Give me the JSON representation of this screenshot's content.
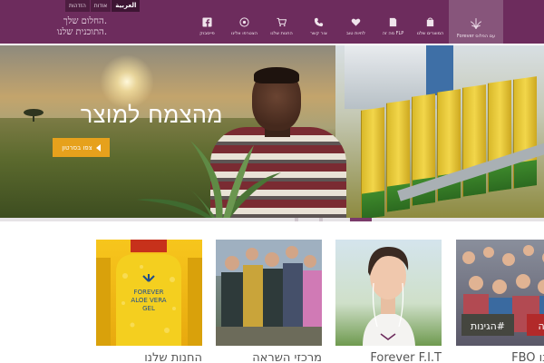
{
  "header": {
    "language_links": [
      "العربية",
      "אודות",
      "הזדהות"
    ],
    "tagline_lines": [
      "החלום שלך.",
      "התוכנית שלנו."
    ],
    "nav": [
      {
        "label": "Forever עם הפלוס",
        "icon": "plus-leaf-icon",
        "active": true
      },
      {
        "label": "המוצרים שלנו",
        "icon": "bag-icon",
        "active": false
      },
      {
        "label": "מה זה FLP",
        "icon": "document-icon",
        "active": false
      },
      {
        "label": "לחיות טוב",
        "icon": "heart-icon",
        "active": false
      },
      {
        "label": "צור קשר",
        "icon": "phone-icon",
        "active": false
      },
      {
        "label": "החנות שלנו",
        "icon": "cart-icon",
        "active": false
      },
      {
        "label": "הצטרפו אלינו",
        "icon": "target-icon",
        "active": false
      },
      {
        "label": "פייסבוק",
        "icon": "facebook-icon",
        "active": false
      }
    ]
  },
  "hero": {
    "title": "מהצמח למוצר",
    "button_label": "צפו בסרטון",
    "button_icon": "play-triangle-icon"
  },
  "colors": {
    "header_bg": "#6d2c5d",
    "nav_active_bg": "#87557b",
    "button_bg": "#e6a11c",
    "slider_active": "#7a3a6a"
  },
  "cards": [
    {
      "title": "FBO שלנו",
      "image": "crowd-people-photo"
    },
    {
      "title": "Forever F.I.T",
      "image": "woman-headphones-photo"
    },
    {
      "title": "מרכזי השראה",
      "image": "group-hikers-photo"
    },
    {
      "title": "החנות שלנו",
      "image": "aloe-vera-gel-bottle-photo"
    }
  ]
}
